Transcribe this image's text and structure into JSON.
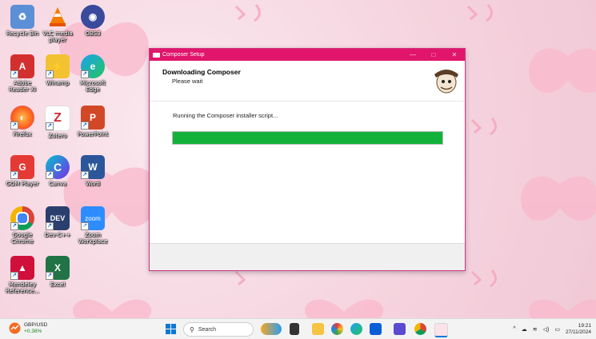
{
  "desktop": {
    "icons": [
      {
        "label": "Recycle Bin",
        "icon": "recycle-bin-icon"
      },
      {
        "label": "VLC media player",
        "icon": "vlc-icon"
      },
      {
        "label": "OBS3",
        "icon": "obs-icon"
      },
      {
        "label": "Adobe Reader XI",
        "icon": "adobe-reader-icon"
      },
      {
        "label": "Winamp",
        "icon": "winamp-icon"
      },
      {
        "label": "Microsoft Edge",
        "icon": "edge-icon"
      },
      {
        "label": "Firefox",
        "icon": "firefox-icon"
      },
      {
        "label": "Zotero",
        "icon": "zotero-icon"
      },
      {
        "label": "PowerPoint",
        "icon": "powerpoint-icon"
      },
      {
        "label": "GOM Player",
        "icon": "gom-player-icon"
      },
      {
        "label": "Canva",
        "icon": "canva-icon"
      },
      {
        "label": "Word",
        "icon": "word-icon"
      },
      {
        "label": "Google Chrome",
        "icon": "chrome-icon"
      },
      {
        "label": "Dev-C++",
        "icon": "dev-cpp-icon"
      },
      {
        "label": "Zoom Workplace",
        "icon": "zoom-icon"
      },
      {
        "label": "Mendeley Reference...",
        "icon": "mendeley-icon"
      },
      {
        "label": "Excel",
        "icon": "excel-icon"
      }
    ]
  },
  "dialog": {
    "title": "Composer Setup",
    "heading": "Downloading Composer",
    "subheading": "Please wait",
    "status": "Running the Composer installer script...",
    "progress": 1.0,
    "controls": {
      "minimize": "—",
      "maximize": "□",
      "close": "✕"
    }
  },
  "taskbar": {
    "weather": {
      "line1": "GBP/USD",
      "line2": "+0.38%"
    },
    "search_placeholder": "Search",
    "clock": {
      "time": "19:21",
      "date": "27/11/2024"
    }
  },
  "colors": {
    "accent": "#e0156b",
    "progress": "#12b23a"
  }
}
